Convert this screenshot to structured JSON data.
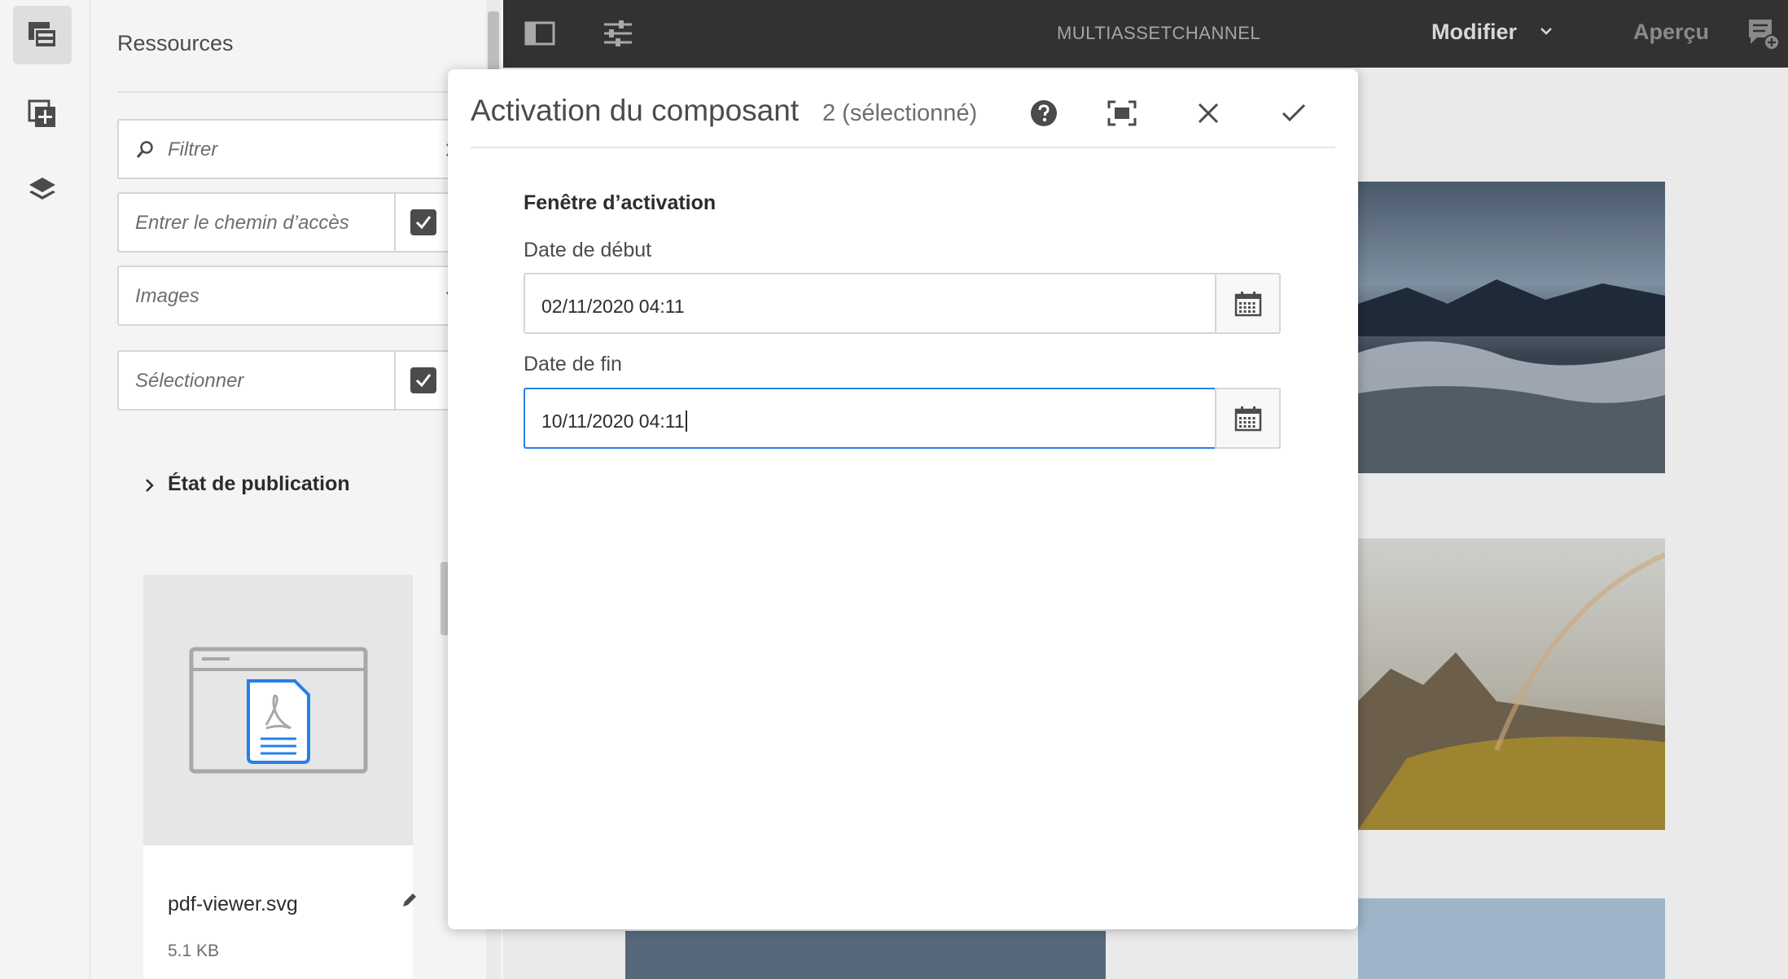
{
  "panel": {
    "title": "Ressources",
    "filter_placeholder": "Filtrer",
    "path_placeholder": "Entrer le chemin d’accès",
    "type_value": "Images",
    "select_placeholder": "Sélectionner",
    "publication_state": "État de publication",
    "card": {
      "name": "pdf-viewer.svg",
      "size": "5.1 KB"
    }
  },
  "topbar": {
    "title": "MULTIASSETCHANNEL",
    "mode": "Modifier",
    "preview": "Aperçu"
  },
  "dialog": {
    "title": "Activation du composant",
    "count": "2 (sélectionné)",
    "section": "Fenêtre d’activation",
    "start_label": "Date de début",
    "start_value": "02/11/2020 04:11",
    "end_label": "Date de fin",
    "end_value": "10/11/2020 04:11"
  },
  "colors": {
    "accent": "#2680eb",
    "topbar": "#323232"
  }
}
